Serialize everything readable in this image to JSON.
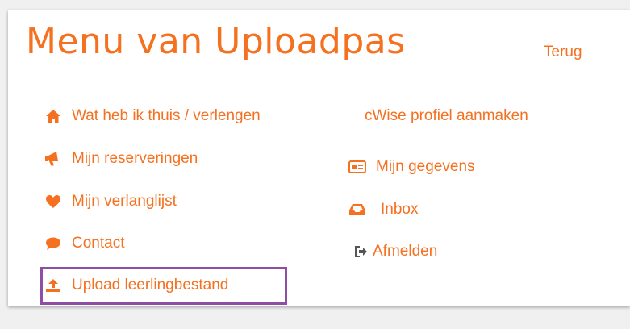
{
  "page": {
    "title": "Menu van Uploadpas",
    "back_link": "Terug"
  },
  "left_menu": [
    {
      "label": "Wat heb ik thuis / verlengen",
      "icon": "home-icon"
    },
    {
      "label": "Mijn reserveringen",
      "icon": "bullhorn-icon"
    },
    {
      "label": "Mijn verlanglijst",
      "icon": "heart-icon"
    },
    {
      "label": "Contact",
      "icon": "chat-bubble-icon"
    },
    {
      "label": "Upload leerlingbestand",
      "icon": "upload-icon"
    }
  ],
  "right_menu": [
    {
      "label": "cWise profiel aanmaken"
    },
    {
      "label": "Mijn gegevens",
      "icon": "id-card-icon"
    },
    {
      "label": "Inbox",
      "icon": "inbox-icon"
    },
    {
      "label": "Afmelden",
      "icon": "sign-out-icon"
    }
  ],
  "colors": {
    "accent": "#f5701f",
    "highlight_border": "#8e4ea6",
    "sign_out_icon": "#555555"
  }
}
